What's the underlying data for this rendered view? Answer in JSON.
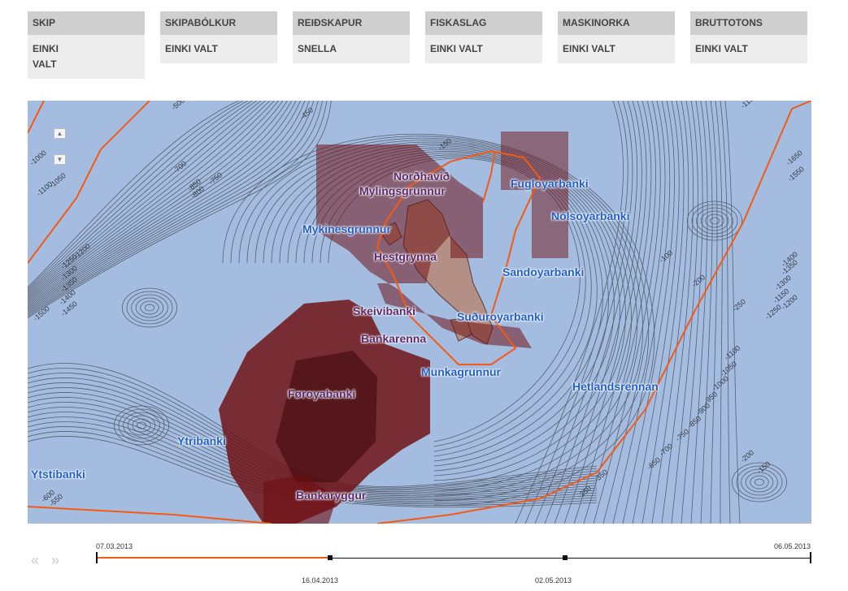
{
  "filters": [
    {
      "label": "SKIP",
      "value": "EINKI VALT"
    },
    {
      "label": "SKIPABÓLKUR",
      "value": "EINKI VALT"
    },
    {
      "label": "REIÐSKAPUR",
      "value": "SNELLA"
    },
    {
      "label": "FISKASLAG",
      "value": "EINKI VALT"
    },
    {
      "label": "MASKINORKA",
      "value": "EINKI VALT"
    },
    {
      "label": "BRUTTOTONS",
      "value": "EINKI VALT"
    }
  ],
  "map": {
    "zoom_in_icon": "triangle-up-icon",
    "zoom_out_icon": "triangle-down-icon",
    "places": [
      {
        "name": "Norðhavið"
      },
      {
        "name": "Mylingsgrunnur"
      },
      {
        "name": "Fugloyarbanki"
      },
      {
        "name": "Nólsoyarbanki"
      },
      {
        "name": "Mykinesgrunnur"
      },
      {
        "name": "Hestgrynna"
      },
      {
        "name": "Sandoyarbanki"
      },
      {
        "name": "Skeivibanki"
      },
      {
        "name": "Suðuroyarbanki"
      },
      {
        "name": "Bankarenna"
      },
      {
        "name": "Munkagrunnur"
      },
      {
        "name": "Hetlandsrennan"
      },
      {
        "name": "Føroyabanki"
      },
      {
        "name": "Ytribanki"
      },
      {
        "name": "Ytstibanki"
      },
      {
        "name": "Bankaryggur"
      }
    ],
    "depth_labels": [
      "-500",
      "-450",
      "-700",
      "-750",
      "-800",
      "-850",
      "-1000",
      "-1100",
      "-1050",
      "-150",
      "-1200",
      "-1250",
      "-1300",
      "-1350",
      "-1400",
      "-1450",
      "-1500",
      "-1150",
      "-100",
      "-200",
      "-250",
      "-1400",
      "-1350",
      "-1650",
      "-1550",
      "-600",
      "-550",
      "-1300",
      "-1200",
      "-1150",
      "-1250",
      "-1100",
      "-1050",
      "-1000",
      "-950",
      "-900",
      "-850",
      "-750",
      "-700",
      "-650",
      "-350",
      "-250",
      "-200",
      "-150"
    ],
    "colors": {
      "sea": "#a4bcdf",
      "contour": "#4a4f5a",
      "boundary": "#f45a14",
      "catch": "#6e0d10",
      "label": "#2060c8",
      "label_dark": "#5a2a6c"
    }
  },
  "timeline": {
    "start": "07.03.2013",
    "end": "06.05.2013",
    "mark1": "16.04.2013",
    "mark2": "02.05.2013",
    "prev_icon": "double-chevron-left-icon",
    "next_icon": "double-chevron-right-icon"
  }
}
